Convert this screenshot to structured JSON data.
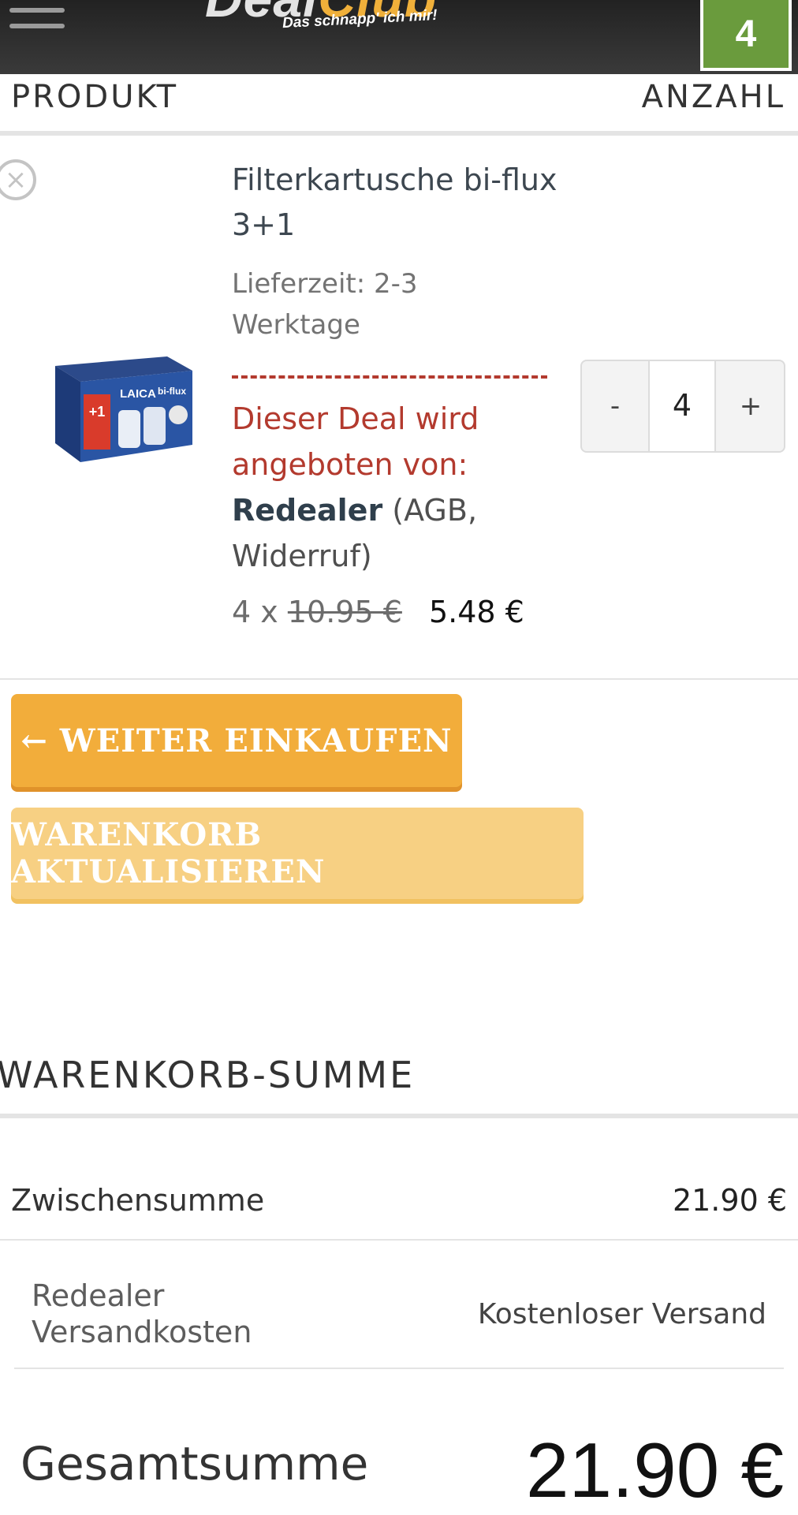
{
  "header": {
    "logo_part1": "Deal",
    "logo_part2": "Club",
    "tagline": "Das schnapp' ich mir!",
    "cart_count": "4",
    "icon_menu": "hamburger-icon"
  },
  "table": {
    "col_product": "PRODUKT",
    "col_quantity": "ANZAHL"
  },
  "item": {
    "remove_icon": "close-icon",
    "name": "Filterkartusche bi-flux 3+1",
    "delivery": "Lieferzeit: 2-3 Werktage",
    "vendor_label": "Dieser Deal wird angeboten von:",
    "vendor_name": "Redealer",
    "vendor_open": "(",
    "vendor_terms": "AGB",
    "vendor_sep": ", ",
    "vendor_withdrawal": "Widerruf",
    "vendor_close": ")",
    "qty_prefix": "4 x",
    "old_price": "10.95 €",
    "new_price": "5.48 €",
    "image_brand": "LAICA",
    "image_product": "bi-flux",
    "image_badge": "+1",
    "stepper": {
      "minus": "-",
      "value": "4",
      "plus": "+"
    }
  },
  "buttons": {
    "continue_shopping": "← WEITER EINKAUFEN",
    "update_cart": "WARENKORB AKTUALISIEREN"
  },
  "summary": {
    "title": "WARENKORB-SUMME",
    "subtotal_label": "Zwischensumme",
    "subtotal_value": "21.90 €",
    "shipping_label": "Redealer Versandkosten",
    "shipping_value": "Kostenloser Versand",
    "total_label": "Gesamtsumme",
    "total_value": "21.90 €"
  },
  "colors": {
    "accent_orange": "#f2ad3b",
    "cart_green": "#6a9b3d",
    "vendor_red": "#b33a2e"
  }
}
